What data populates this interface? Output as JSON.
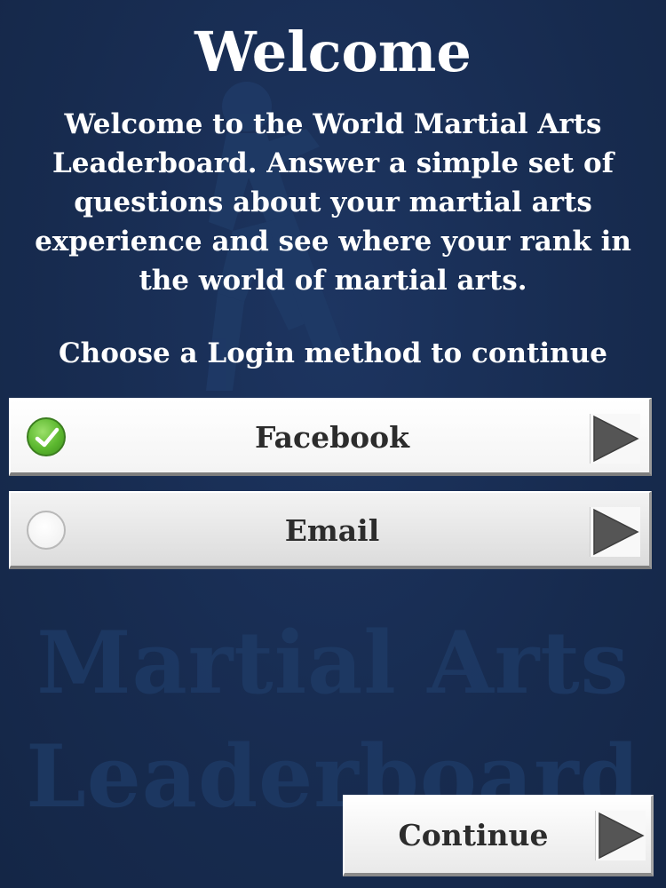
{
  "header": {
    "title": "Welcome"
  },
  "intro": {
    "text": "Welcome to the World Martial Arts Leaderboard. Answer a simple set of questions about your martial arts experience and see where your rank in the world of martial arts."
  },
  "login": {
    "prompt": "Choose a Login method to continue",
    "options": [
      {
        "label": "Facebook",
        "selected": true
      },
      {
        "label": "Email",
        "selected": false
      }
    ]
  },
  "background": {
    "watermark_line1": "Martial Arts",
    "watermark_line2": "Leaderboard"
  },
  "footer": {
    "continue_label": "Continue"
  },
  "icons": {
    "selected": "check-circle-icon",
    "unselected": "empty-circle-icon",
    "arrow": "play-arrow-icon"
  },
  "colors": {
    "background": "#182d52",
    "text": "#ffffff",
    "check_green": "#5cb82f",
    "arrow_gray": "#555555"
  }
}
